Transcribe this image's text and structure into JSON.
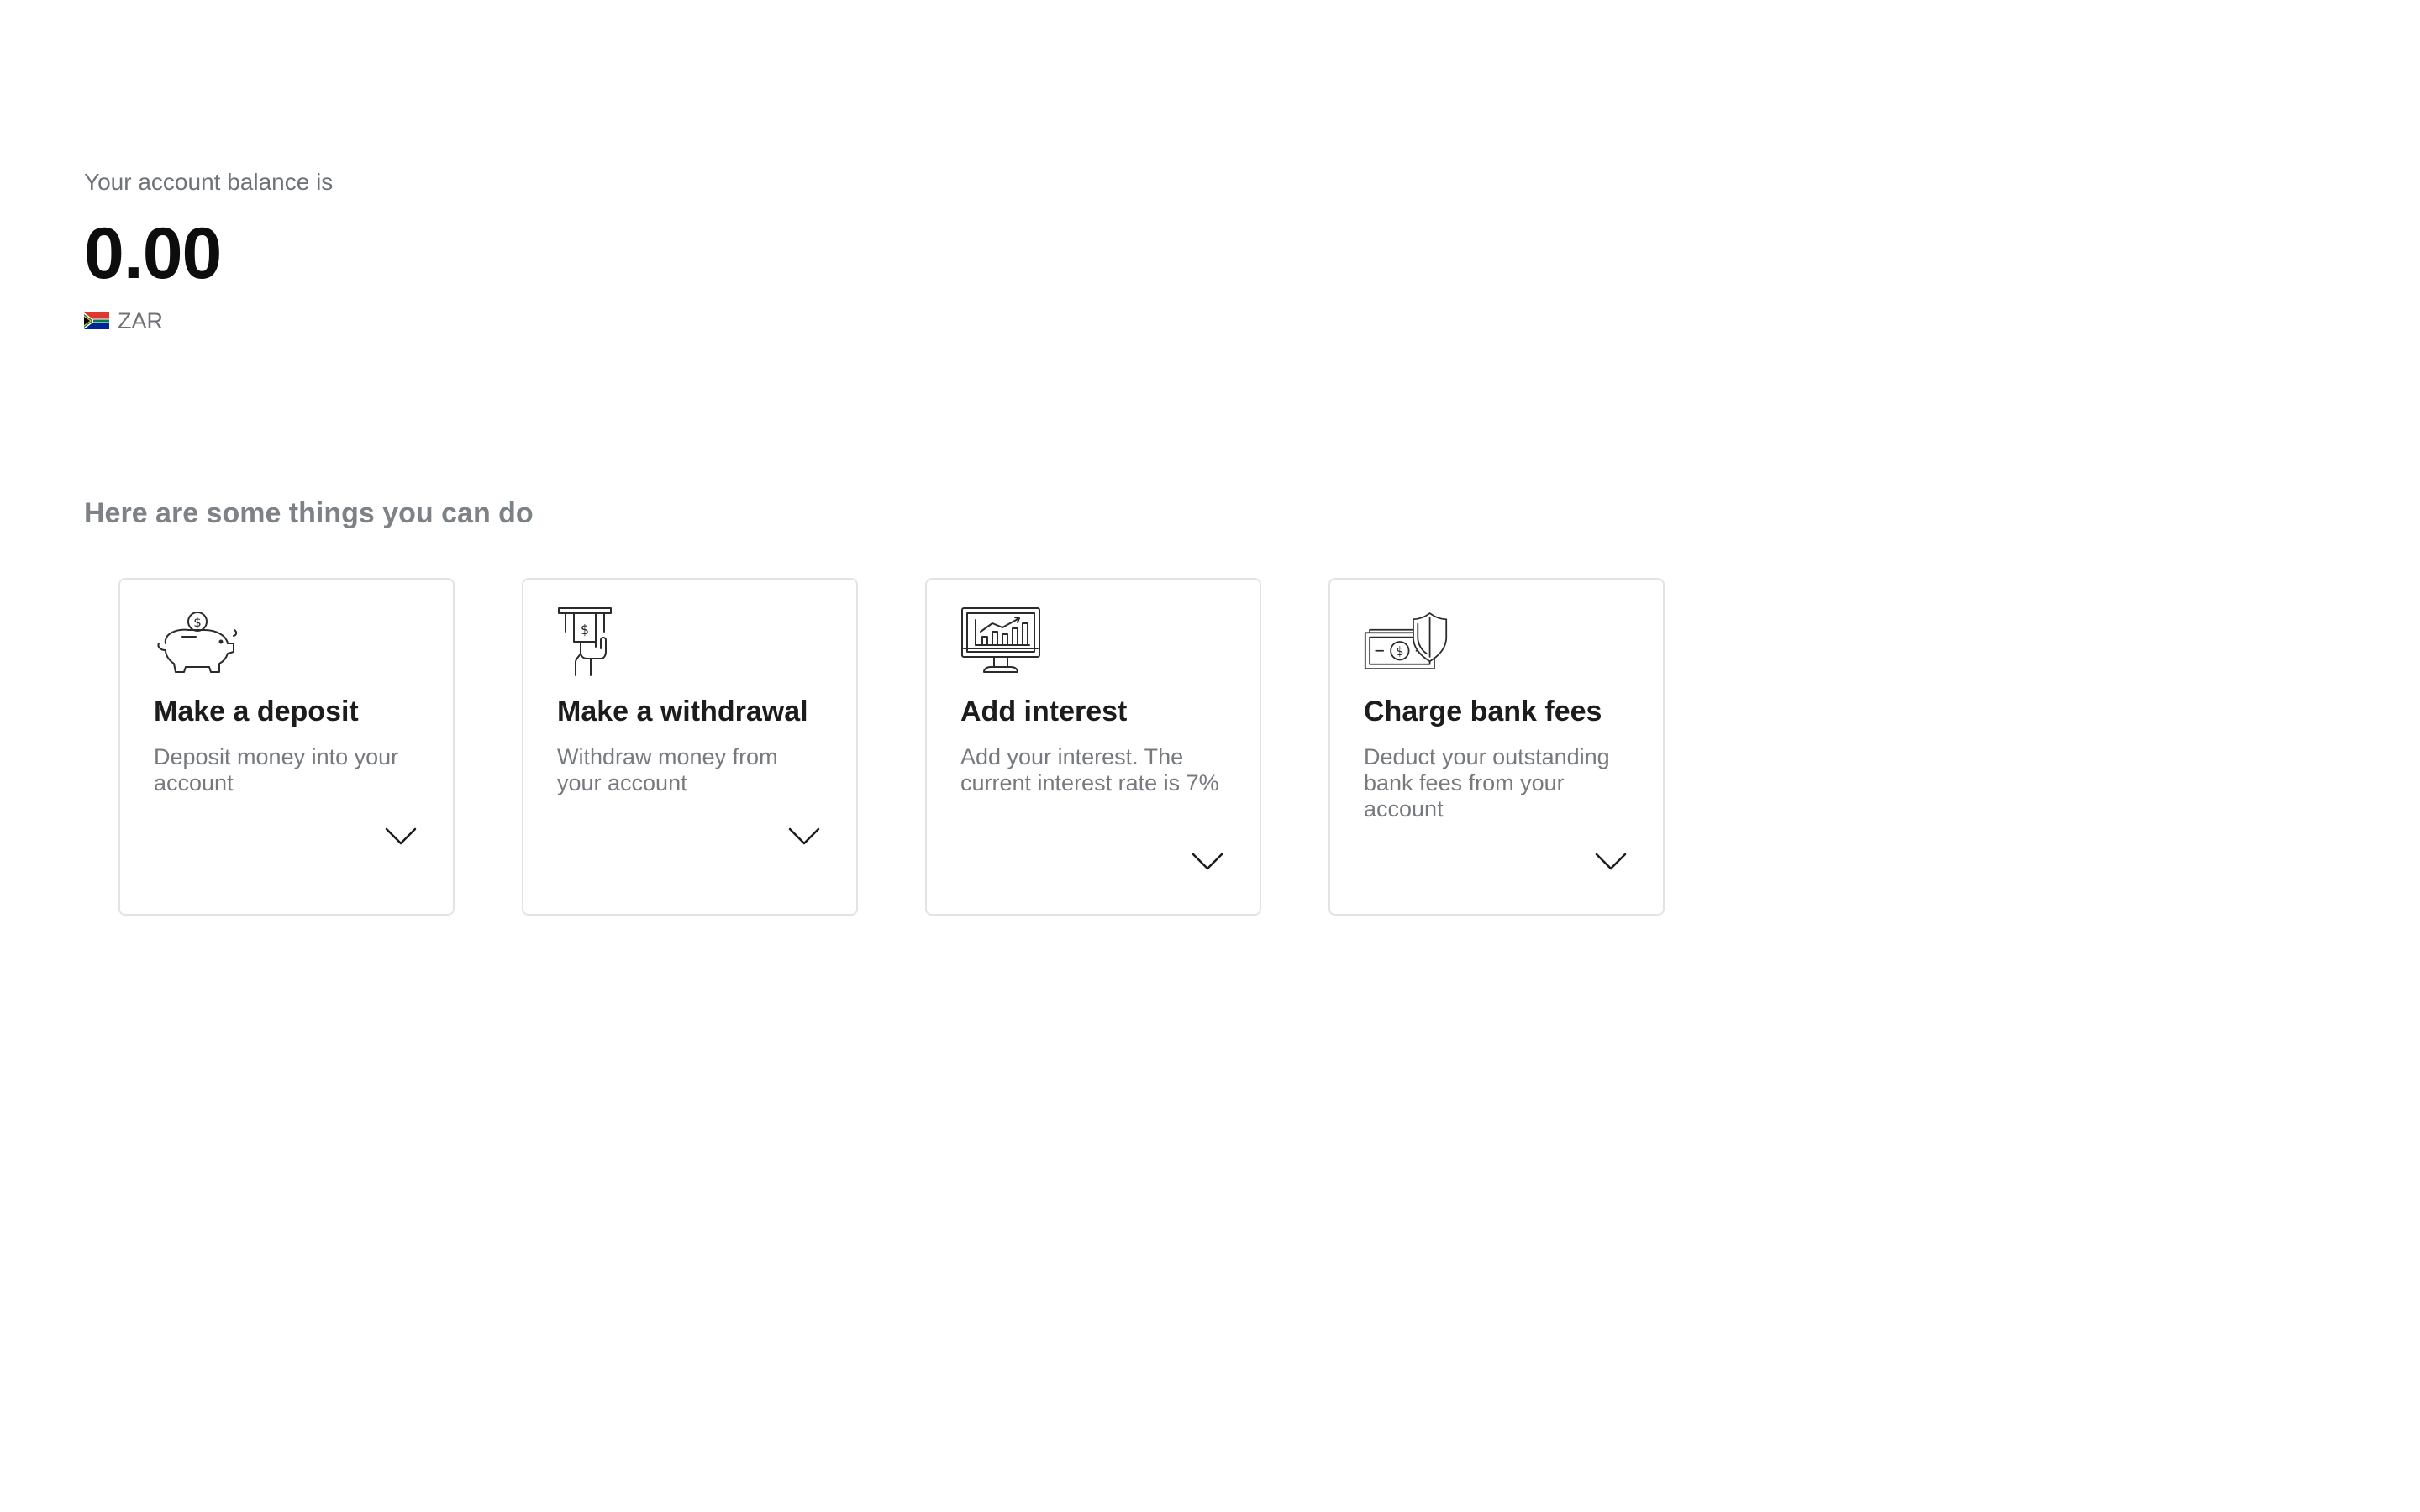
{
  "balance": {
    "label": "Your account balance is",
    "amount": "0.00",
    "currency": "ZAR",
    "currency_flag_icon": "south-africa-flag-icon"
  },
  "actions_section": {
    "heading": "Here are some things you can do",
    "cards": [
      {
        "icon": "piggy-bank-icon",
        "title": "Make a deposit",
        "description": "Deposit money into your account",
        "expand_icon": "chevron-down-icon"
      },
      {
        "icon": "atm-withdrawal-icon",
        "title": "Make a withdrawal",
        "description": "Withdraw money from your account",
        "expand_icon": "chevron-down-icon"
      },
      {
        "icon": "monitor-chart-icon",
        "title": "Add interest",
        "description": "Add your interest. The current interest rate is 7%",
        "expand_icon": "chevron-down-icon"
      },
      {
        "icon": "banknote-shield-icon",
        "title": "Charge bank fees",
        "description": "Deduct your outstanding bank fees from your account",
        "expand_icon": "chevron-down-icon"
      }
    ]
  },
  "colors": {
    "text_primary": "#1c1c1c",
    "text_muted": "#76797d",
    "card_border": "#e3e3e3",
    "background": "#ffffff"
  }
}
